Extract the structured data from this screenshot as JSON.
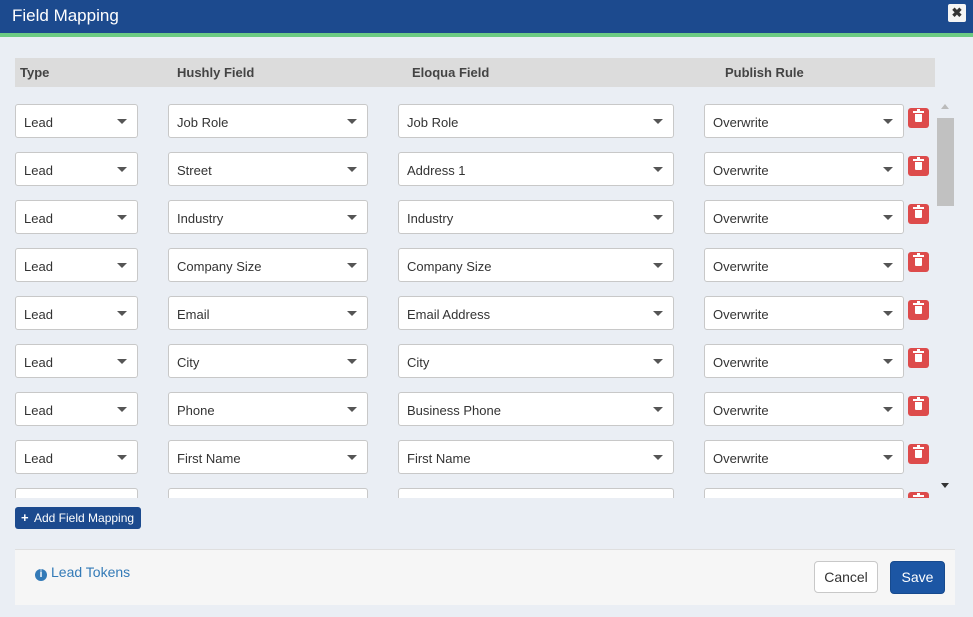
{
  "dialog": {
    "title": "Field Mapping",
    "close_label": "✖"
  },
  "columns": {
    "type": "Type",
    "hushly": "Hushly Field",
    "eloqua": "Eloqua Field",
    "rule": "Publish Rule"
  },
  "rows": [
    {
      "type": "Lead",
      "hushly": "Job Role",
      "eloqua": "Job Role",
      "rule": "Overwrite"
    },
    {
      "type": "Lead",
      "hushly": "Street",
      "eloqua": "Address 1",
      "rule": "Overwrite"
    },
    {
      "type": "Lead",
      "hushly": "Industry",
      "eloqua": "Industry",
      "rule": "Overwrite"
    },
    {
      "type": "Lead",
      "hushly": "Company Size",
      "eloqua": "Company Size",
      "rule": "Overwrite"
    },
    {
      "type": "Lead",
      "hushly": "Email",
      "eloqua": "Email Address",
      "rule": "Overwrite"
    },
    {
      "type": "Lead",
      "hushly": "City",
      "eloqua": "City",
      "rule": "Overwrite"
    },
    {
      "type": "Lead",
      "hushly": "Phone",
      "eloqua": "Business Phone",
      "rule": "Overwrite"
    },
    {
      "type": "Lead",
      "hushly": "First Name",
      "eloqua": "First Name",
      "rule": "Overwrite"
    },
    {
      "type": "",
      "hushly": "",
      "eloqua": "",
      "rule": ""
    }
  ],
  "add_button": {
    "icon": "+",
    "label": "Add Field Mapping"
  },
  "footer": {
    "info_icon": "i",
    "tokens_label": "Lead Tokens",
    "cancel_label": "Cancel",
    "save_label": "Save"
  },
  "colors": {
    "primary": "#1c4a8e",
    "accent_green": "#6ccb82",
    "danger": "#dd4b4b",
    "link": "#337ab7"
  }
}
